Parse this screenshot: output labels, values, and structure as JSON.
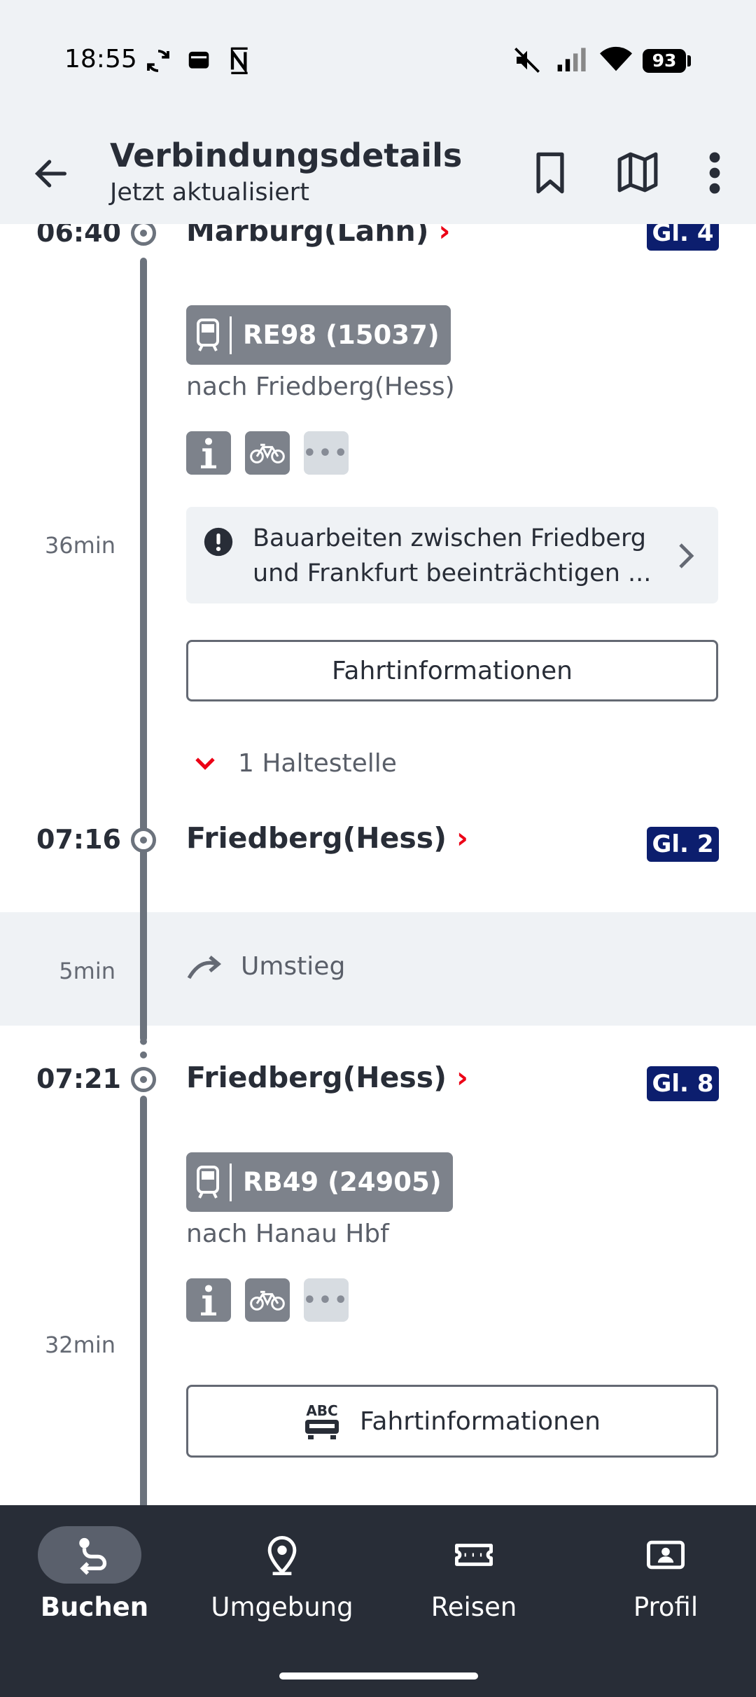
{
  "status_bar": {
    "time": "18:55",
    "battery": "93",
    "icons": [
      "sync-icon",
      "wallet-icon",
      "nfc-icon",
      "mute-icon",
      "signal-icon",
      "wifi-icon",
      "battery-icon"
    ]
  },
  "app_bar": {
    "title": "Verbindungsdetails",
    "subtitle": "Jetzt aktualisiert",
    "icons": [
      "back-arrow-icon",
      "bookmark-icon",
      "map-icon",
      "more-vert-icon"
    ]
  },
  "legs": [
    {
      "departure_time": "06:40",
      "departure_station": "Marburg(Lahn)",
      "departure_platform": "Gl. 4",
      "train": "RE98 (15037)",
      "direction": "nach Friedberg(Hess)",
      "duration": "36min",
      "notice": "Bauarbeiten zwischen Friedberg und Frankfurt beeinträchtigen ...",
      "button": "Fahrtinformationen",
      "stops": "1 Haltestelle",
      "arrival_time": "07:16",
      "arrival_station": "Friedberg(Hess)",
      "arrival_platform": "Gl. 2"
    },
    {
      "departure_time": "07:21",
      "departure_station": "Friedberg(Hess)",
      "departure_platform": "Gl. 8",
      "train": "RB49 (24905)",
      "direction": "nach Hanau Hbf",
      "duration": "32min",
      "button": "Fahrtinformationen",
      "button_icon_text": "ABC"
    }
  ],
  "transfer": {
    "duration": "5min",
    "label": "Umstieg"
  },
  "colors": {
    "accent_red": "#ec0016",
    "platform_blue": "#0c1e6e",
    "nav_background": "#282d37",
    "header_background": "#eff2f5"
  },
  "bottom_nav": [
    {
      "label": "Buchen",
      "icon": "route-icon",
      "active": true
    },
    {
      "label": "Umgebung",
      "icon": "location-pin-icon",
      "active": false
    },
    {
      "label": "Reisen",
      "icon": "ticket-icon",
      "active": false
    },
    {
      "label": "Profil",
      "icon": "profile-card-icon",
      "active": false
    }
  ]
}
